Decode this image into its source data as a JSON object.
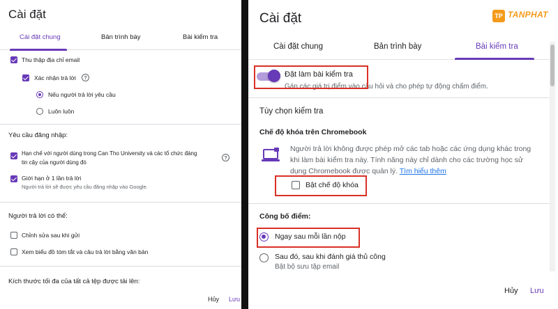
{
  "left": {
    "title": "Cài đặt",
    "tabs": [
      "Cài đặt chung",
      "Bản trình bày",
      "Bài kiểm tra"
    ],
    "collect_email": "Thu thập địa chỉ email",
    "confirm_response": "Xác nhận trả lời",
    "option_if_requested": "Nếu người trả lời yêu cầu",
    "option_always": "Luôn luôn",
    "login_required_heading": "Yêu cầu đăng nhập:",
    "restrict_line1": "Hạn chế với người dùng trong Can Tho University và các tổ chức đáng",
    "restrict_line2": "tin cậy của người dùng đó",
    "limit_one": "Giới hạn ở 1 lần trả lời",
    "limit_one_sub": "Người trả lời sẽ được yêu cầu đăng nhập vào Google.",
    "respondents_can": "Người trả lời có thể:",
    "edit_after_submit": "Chỉnh sửa sau khi gửi",
    "view_summary": "Xem biểu đồ tóm tắt và câu trả lời bằng văn bản",
    "max_file_size": "Kích thước tối đa của tất cả tệp được tải lên:",
    "cancel": "Hủy",
    "save": "Lưu"
  },
  "right": {
    "title": "Cài đặt",
    "logo_name": "TANPHAT",
    "logo_mark": "TP",
    "tabs": [
      "Cài đặt chung",
      "Bản trình bày",
      "Bài kiểm tra"
    ],
    "make_quiz": "Đặt làm bài kiểm tra",
    "make_quiz_sub": "Gán các giá trị điểm vào câu hỏi và cho phép tự động chấm điểm.",
    "quiz_options": "Tùy chọn kiểm tra",
    "lock_mode_heading": "Chế độ khóa trên Chromebook",
    "lock_mode_desc_1": "Người trả lời không được phép mở các tab hoặc các ứng dụng khác trong",
    "lock_mode_desc_2": "khi làm bài kiểm tra này. Tính năng này chỉ dành cho các trường học sử",
    "lock_mode_desc_3": "dụng Chromebook được quản lý.",
    "learn_more": "Tìm hiểu thêm",
    "enable_lock": "Bật chế độ khóa",
    "release_grade": "Công bố điểm:",
    "immediately": "Ngay sau mỗi lần nộp",
    "later": "Sau đó, sau khi đánh giá thủ công",
    "later_sub": "Bật bộ sưu tập email",
    "cancel": "Hủy",
    "save": "Lưu"
  },
  "colors": {
    "accent": "#673ab7",
    "highlight_box": "#d93025",
    "link": "#1a73e8",
    "brand": "#f49a1a"
  }
}
